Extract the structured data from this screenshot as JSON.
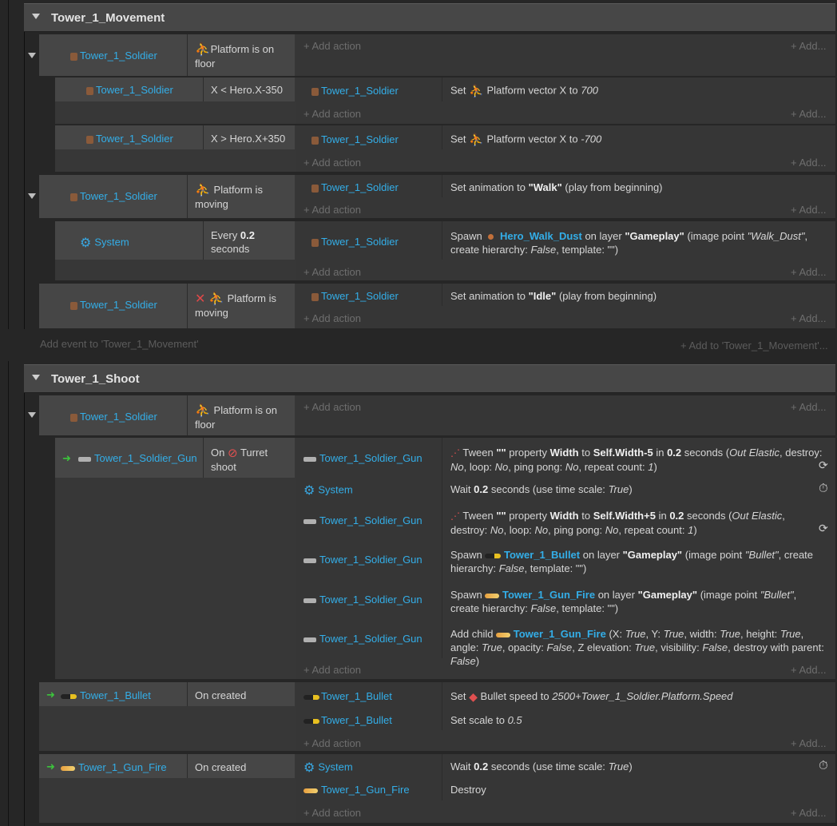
{
  "colors": {
    "accent": "#33aee8",
    "group_header": "#474747",
    "condition_bg": "#464646",
    "action_bg": "#363636"
  },
  "common": {
    "add_action": "Add action",
    "add": "Add..."
  },
  "group1": {
    "title": "Tower_1_Movement",
    "ev1": {
      "obj": "Tower_1_Soldier",
      "cond": "Platform is on floor"
    },
    "ev1a": {
      "obj": "Tower_1_Soldier",
      "cond": "X < Hero.X-350",
      "act_obj": "Tower_1_Soldier",
      "act_pre": "Set",
      "act_mid": "Platform vector X to",
      "act_val": "700"
    },
    "ev1b": {
      "obj": "Tower_1_Soldier",
      "cond": "X > Hero.X+350",
      "act_obj": "Tower_1_Soldier",
      "act_pre": "Set",
      "act_mid": "Platform vector X to",
      "act_val": "-700"
    },
    "ev2": {
      "obj": "Tower_1_Soldier",
      "cond": "Platform is moving",
      "act_obj": "Tower_1_Soldier",
      "a1": "Set animation to",
      "a2": "\"Walk\"",
      "a3": "(play from beginning)"
    },
    "ev2a": {
      "obj": "System",
      "cond1": "Every",
      "cond2": "0.2",
      "cond3": "seconds",
      "act_obj": "Tower_1_Soldier",
      "s1": "Spawn",
      "s2": "Hero_Walk_Dust",
      "s3": "on layer",
      "s4": "\"Gameplay\"",
      "s5": "(image point",
      "s6": "\"Walk_Dust\"",
      "s7": ",",
      "s8": "create hierarchy:",
      "s9": "False",
      "s10": ", template: \"\")"
    },
    "ev3": {
      "obj": "Tower_1_Soldier",
      "cond": "Platform is moving",
      "act_obj": "Tower_1_Soldier",
      "a1": "Set animation to",
      "a2": "\"Idle\"",
      "a3": "(play from beginning)"
    },
    "add_event": "Add event to 'Tower_1_Movement'",
    "add_to": "Add to 'Tower_1_Movement'..."
  },
  "group2": {
    "title": "Tower_1_Shoot",
    "ev1": {
      "obj": "Tower_1_Soldier",
      "cond": "Platform is on floor"
    },
    "ev2": {
      "obj": "Tower_1_Soldier_Gun",
      "c1": "On",
      "c2": "Turret shoot"
    },
    "acts": [
      {
        "obj": "Tower_1_Soldier_Gun",
        "t1": "Tween",
        "t2": "\"\"",
        "t3": "property",
        "t4": "Width",
        "t5": "to",
        "t6": "Self.Width-5",
        "t7": "in",
        "t8": "0.2",
        "t9": "seconds (",
        "t10": "Out Elastic",
        "t11": ", destroy:",
        "t12": "No",
        "t13": ", loop:",
        "t14": "No",
        "t15": ", ping pong:",
        "t16": "No",
        "t17": ", repeat count:",
        "t18": "1",
        "t19": ")"
      },
      {
        "obj": "System",
        "t1": "Wait",
        "t2": "0.2",
        "t3": "seconds (use time scale:",
        "t4": "True",
        "t5": ")"
      },
      {
        "obj": "Tower_1_Soldier_Gun",
        "t1": "Tween",
        "t2": "\"\"",
        "t3": "property",
        "t4": "Width",
        "t5": "to",
        "t6": "Self.Width+5",
        "t7": "in",
        "t8": "0.2",
        "t9": "seconds (",
        "t10": "Out Elastic",
        "t11": ",",
        "t12": "destroy:",
        "t13": "No",
        "t14": ", loop:",
        "t15": "No",
        "t16": ", ping pong:",
        "t17": "No",
        "t18": ", repeat count:",
        "t19": "1",
        "t20": ")"
      },
      {
        "obj": "Tower_1_Soldier_Gun",
        "t1": "Spawn",
        "t2": "Tower_1_Bullet",
        "t3": "on layer",
        "t4": "\"Gameplay\"",
        "t5": "(image point",
        "t6": "\"Bullet\"",
        "t7": ", create",
        "t8": "hierarchy:",
        "t9": "False",
        "t10": ", template: \"\")"
      },
      {
        "obj": "Tower_1_Soldier_Gun",
        "t1": "Spawn",
        "t2": "Tower_1_Gun_Fire",
        "t3": "on layer",
        "t4": "\"Gameplay\"",
        "t5": "(image point",
        "t6": "\"Bullet\"",
        "t7": ", create",
        "t8": "hierarchy:",
        "t9": "False",
        "t10": ", template: \"\")"
      },
      {
        "obj": "Tower_1_Soldier_Gun",
        "t1": "Add child",
        "t2": "Tower_1_Gun_Fire",
        "t3": "(X:",
        "t4": "True",
        "t5": ", Y:",
        "t6": "True",
        "t7": ", width:",
        "t8": "True",
        "t9": ", height:",
        "t10": "True",
        "t11": ", angle:",
        "t12": "True",
        "t13": ", opacity:",
        "t14": "False",
        "t15": ", Z elevation:",
        "t16": "True",
        "t17": ", visibility:",
        "t18": "False",
        "t19": ", destroy with parent:",
        "t20": "False",
        "t21": ")"
      }
    ],
    "ev3": {
      "obj": "Tower_1_Bullet",
      "cond": "On created",
      "act1_obj": "Tower_1_Bullet",
      "a1": "Set",
      "a2": "Bullet speed to",
      "a3": "2500+Tower_1_Soldier.Platform.Speed",
      "act2_obj": "Tower_1_Bullet",
      "b1": "Set scale to",
      "b2": "0.5"
    },
    "ev4": {
      "obj": "Tower_1_Gun_Fire",
      "cond": "On created",
      "act1_obj": "System",
      "w1": "Wait",
      "w2": "0.2",
      "w3": "seconds (use time scale:",
      "w4": "True",
      "w5": ")",
      "act2_obj": "Tower_1_Gun_Fire",
      "d1": "Destroy"
    }
  }
}
